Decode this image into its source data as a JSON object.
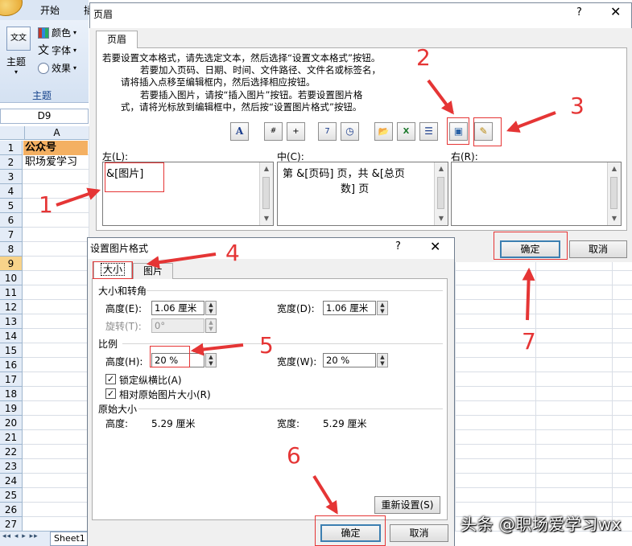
{
  "excel": {
    "tabs": [
      "开始",
      "插"
    ],
    "ribbon": {
      "theme_label": "主题",
      "theme_icon_text": "文文",
      "colors": "颜色",
      "fonts": "字体",
      "effects": "效果",
      "group": "主题",
      "dropdown": "▾"
    },
    "name_box": "D9",
    "column_a": "A",
    "rows": [
      "1",
      "2",
      "3",
      "4",
      "5",
      "6",
      "7",
      "8",
      "9",
      "10",
      "11",
      "12",
      "13",
      "14",
      "15",
      "16",
      "17",
      "18",
      "19",
      "20",
      "21",
      "22",
      "23",
      "24",
      "25",
      "26",
      "27"
    ],
    "selected_row": "9",
    "cells": {
      "a1": "公众号",
      "a2": "职场爱学习"
    },
    "sheet_tab": "Sheet1",
    "sheet_nav": "◂◂ ◂ ▸ ▸▸"
  },
  "header_dialog": {
    "title": "页眉",
    "help": "?",
    "close": "✕",
    "tab": "页眉",
    "instructions": [
      "若要设置文本格式，请先选定文本，然后选择“设置文本格式”按钮。",
      "若要加入页码、日期、时间、文件路径、文件名或标签名，",
      "请将插入点移至编辑框内，然后选择相应按钮。",
      "若要插入图片，请按“插入图片”按钮。若要设置图片格",
      "式，请将光标放到编辑框中，然后按“设置图片格式”按钮。"
    ],
    "toolbar_glyphs": [
      "A",
      "#",
      "+",
      "7",
      "◷",
      "📂",
      "X",
      "☰",
      "▣",
      "✎"
    ],
    "left_label": "左(L):",
    "center_label": "中(C):",
    "right_label": "右(R):",
    "left_content": "&[图片]",
    "center_line1": "第 &[页码] 页，共 &[总页",
    "center_line2": "数] 页",
    "right_content": "",
    "ok": "确定",
    "cancel": "取消"
  },
  "picture_dialog": {
    "title": "设置图片格式",
    "help": "?",
    "close": "✕",
    "tab_size": "大小",
    "tab_picture": "图片",
    "size_rotate_group": "大小和转角",
    "height_label": "高度(E):",
    "height_value": "1.06 厘米",
    "width_label": "宽度(D):",
    "width_value": "1.06 厘米",
    "rotate_label": "旋转(T):",
    "rotate_value": "0°",
    "scale_group": "比例",
    "scale_height_label": "高度(H):",
    "scale_height_value": "20 %",
    "scale_width_label": "宽度(W):",
    "scale_width_value": "20 %",
    "lock_ratio_label": "锁定纵横比(A)",
    "lock_ratio_checked": "✓",
    "relative_label": "相对原始图片大小(R)",
    "relative_checked": "✓",
    "original_group": "原始大小",
    "orig_height_label": "高度:",
    "orig_height_value": "5.29 厘米",
    "orig_width_label": "宽度:",
    "orig_width_value": "5.29 厘米",
    "reset": "重新设置(S)",
    "ok": "确定",
    "cancel": "取消"
  },
  "annotations": {
    "n1": "1",
    "n2": "2",
    "n3": "3",
    "n4": "4",
    "n5": "5",
    "n6": "6",
    "n7": "7",
    "color": "#e53535"
  },
  "watermark": "头条 @职场爱学习wx"
}
